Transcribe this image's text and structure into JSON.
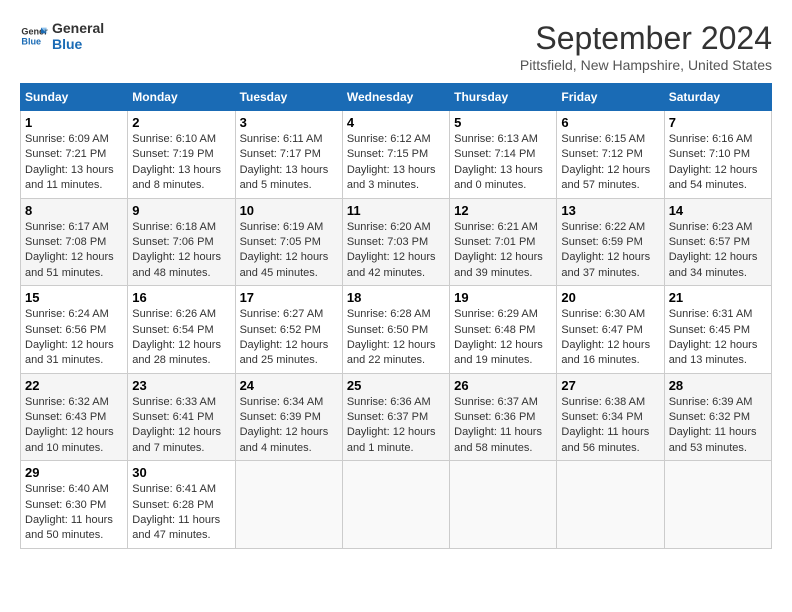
{
  "header": {
    "logo_text_general": "General",
    "logo_text_blue": "Blue",
    "month_title": "September 2024",
    "location": "Pittsfield, New Hampshire, United States"
  },
  "weekdays": [
    "Sunday",
    "Monday",
    "Tuesday",
    "Wednesday",
    "Thursday",
    "Friday",
    "Saturday"
  ],
  "weeks": [
    [
      {
        "day": "1",
        "info": "Sunrise: 6:09 AM\nSunset: 7:21 PM\nDaylight: 13 hours\nand 11 minutes."
      },
      {
        "day": "2",
        "info": "Sunrise: 6:10 AM\nSunset: 7:19 PM\nDaylight: 13 hours\nand 8 minutes."
      },
      {
        "day": "3",
        "info": "Sunrise: 6:11 AM\nSunset: 7:17 PM\nDaylight: 13 hours\nand 5 minutes."
      },
      {
        "day": "4",
        "info": "Sunrise: 6:12 AM\nSunset: 7:15 PM\nDaylight: 13 hours\nand 3 minutes."
      },
      {
        "day": "5",
        "info": "Sunrise: 6:13 AM\nSunset: 7:14 PM\nDaylight: 13 hours\nand 0 minutes."
      },
      {
        "day": "6",
        "info": "Sunrise: 6:15 AM\nSunset: 7:12 PM\nDaylight: 12 hours\nand 57 minutes."
      },
      {
        "day": "7",
        "info": "Sunrise: 6:16 AM\nSunset: 7:10 PM\nDaylight: 12 hours\nand 54 minutes."
      }
    ],
    [
      {
        "day": "8",
        "info": "Sunrise: 6:17 AM\nSunset: 7:08 PM\nDaylight: 12 hours\nand 51 minutes."
      },
      {
        "day": "9",
        "info": "Sunrise: 6:18 AM\nSunset: 7:06 PM\nDaylight: 12 hours\nand 48 minutes."
      },
      {
        "day": "10",
        "info": "Sunrise: 6:19 AM\nSunset: 7:05 PM\nDaylight: 12 hours\nand 45 minutes."
      },
      {
        "day": "11",
        "info": "Sunrise: 6:20 AM\nSunset: 7:03 PM\nDaylight: 12 hours\nand 42 minutes."
      },
      {
        "day": "12",
        "info": "Sunrise: 6:21 AM\nSunset: 7:01 PM\nDaylight: 12 hours\nand 39 minutes."
      },
      {
        "day": "13",
        "info": "Sunrise: 6:22 AM\nSunset: 6:59 PM\nDaylight: 12 hours\nand 37 minutes."
      },
      {
        "day": "14",
        "info": "Sunrise: 6:23 AM\nSunset: 6:57 PM\nDaylight: 12 hours\nand 34 minutes."
      }
    ],
    [
      {
        "day": "15",
        "info": "Sunrise: 6:24 AM\nSunset: 6:56 PM\nDaylight: 12 hours\nand 31 minutes."
      },
      {
        "day": "16",
        "info": "Sunrise: 6:26 AM\nSunset: 6:54 PM\nDaylight: 12 hours\nand 28 minutes."
      },
      {
        "day": "17",
        "info": "Sunrise: 6:27 AM\nSunset: 6:52 PM\nDaylight: 12 hours\nand 25 minutes."
      },
      {
        "day": "18",
        "info": "Sunrise: 6:28 AM\nSunset: 6:50 PM\nDaylight: 12 hours\nand 22 minutes."
      },
      {
        "day": "19",
        "info": "Sunrise: 6:29 AM\nSunset: 6:48 PM\nDaylight: 12 hours\nand 19 minutes."
      },
      {
        "day": "20",
        "info": "Sunrise: 6:30 AM\nSunset: 6:47 PM\nDaylight: 12 hours\nand 16 minutes."
      },
      {
        "day": "21",
        "info": "Sunrise: 6:31 AM\nSunset: 6:45 PM\nDaylight: 12 hours\nand 13 minutes."
      }
    ],
    [
      {
        "day": "22",
        "info": "Sunrise: 6:32 AM\nSunset: 6:43 PM\nDaylight: 12 hours\nand 10 minutes."
      },
      {
        "day": "23",
        "info": "Sunrise: 6:33 AM\nSunset: 6:41 PM\nDaylight: 12 hours\nand 7 minutes."
      },
      {
        "day": "24",
        "info": "Sunrise: 6:34 AM\nSunset: 6:39 PM\nDaylight: 12 hours\nand 4 minutes."
      },
      {
        "day": "25",
        "info": "Sunrise: 6:36 AM\nSunset: 6:37 PM\nDaylight: 12 hours\nand 1 minute."
      },
      {
        "day": "26",
        "info": "Sunrise: 6:37 AM\nSunset: 6:36 PM\nDaylight: 11 hours\nand 58 minutes."
      },
      {
        "day": "27",
        "info": "Sunrise: 6:38 AM\nSunset: 6:34 PM\nDaylight: 11 hours\nand 56 minutes."
      },
      {
        "day": "28",
        "info": "Sunrise: 6:39 AM\nSunset: 6:32 PM\nDaylight: 11 hours\nand 53 minutes."
      }
    ],
    [
      {
        "day": "29",
        "info": "Sunrise: 6:40 AM\nSunset: 6:30 PM\nDaylight: 11 hours\nand 50 minutes."
      },
      {
        "day": "30",
        "info": "Sunrise: 6:41 AM\nSunset: 6:28 PM\nDaylight: 11 hours\nand 47 minutes."
      },
      {
        "day": "",
        "info": ""
      },
      {
        "day": "",
        "info": ""
      },
      {
        "day": "",
        "info": ""
      },
      {
        "day": "",
        "info": ""
      },
      {
        "day": "",
        "info": ""
      }
    ]
  ]
}
